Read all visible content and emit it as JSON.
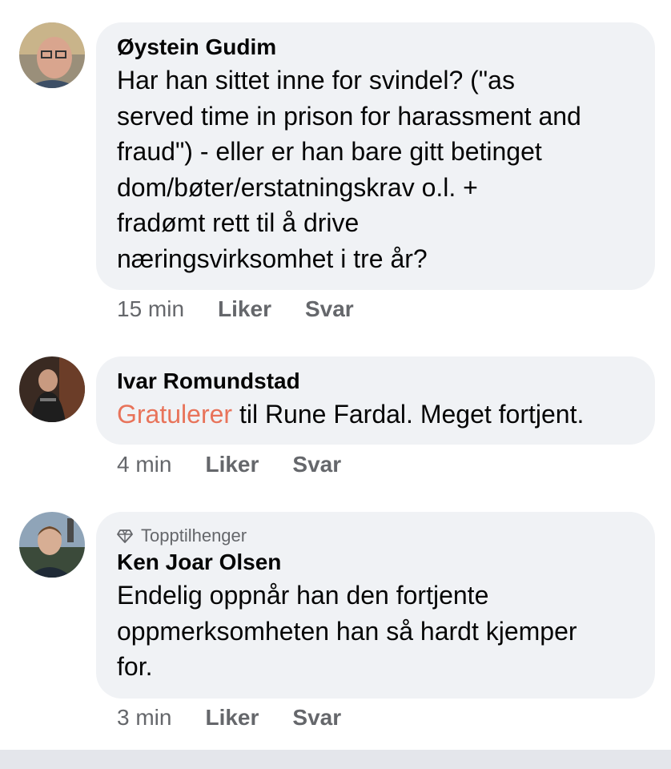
{
  "comments": [
    {
      "author": "Øystein Gudim",
      "text_lines": [
        "Har han sittet inne for svindel? (\"as",
        "served time in prison for harassment and",
        "fraud\") - eller er han bare gitt betinget",
        "dom/bøter/erstatningskrav o.l. +",
        "fradømt rett til å drive",
        "næringsvirksomhet i tre år?"
      ],
      "time": "15 min",
      "like_label": "Liker",
      "reply_label": "Svar"
    },
    {
      "author": "Ivar Romundstad",
      "highlight_word": "Gratulerer",
      "text_rest": " til Rune Fardal. Meget fortjent.",
      "time": "4 min",
      "like_label": "Liker",
      "reply_label": "Svar"
    },
    {
      "badge": "Topptilhenger",
      "badge_icon": "diamond-icon",
      "author": "Ken Joar Olsen",
      "text_lines": [
        "Endelig oppnår han den fortjente",
        "oppmerksomheten han så hardt kjemper",
        "for."
      ],
      "time": "3 min",
      "like_label": "Liker",
      "reply_label": "Svar"
    }
  ],
  "colors": {
    "bubble_bg": "#f0f2f5",
    "highlight": "#e8735a",
    "meta_text": "#65676b",
    "primary_text": "#050505"
  }
}
